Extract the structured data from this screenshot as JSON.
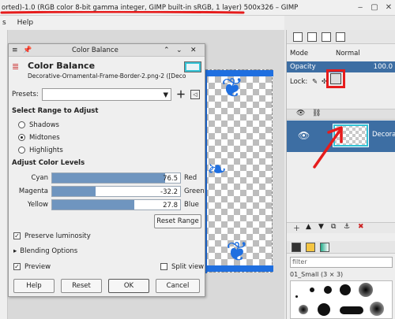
{
  "window": {
    "title": "orted)-1.0 (RGB color 8-bit gamma integer, GIMP built-in sRGB, 1 layer) 500x326 – GIMP"
  },
  "menubar": {
    "items": [
      "s",
      "Help"
    ]
  },
  "dialog": {
    "title": "Color Balance",
    "header_name": "Color Balance",
    "header_file": "Decorative-Ornamental-Frame-Border-2.png-2 ([Deco",
    "presets_label": "Presets:",
    "presets_value": "",
    "range_heading": "Select Range to Adjust",
    "ranges": [
      {
        "label": "Shadows",
        "selected": false
      },
      {
        "label": "Midtones",
        "selected": true
      },
      {
        "label": "Highlights",
        "selected": false
      }
    ],
    "levels_heading": "Adjust Color Levels",
    "sliders": [
      {
        "left": "Cyan",
        "right": "Red",
        "value": "76.5",
        "fraction": 0.88
      },
      {
        "left": "Magenta",
        "right": "Green",
        "value": "-32.2",
        "fraction": 0.34
      },
      {
        "left": "Yellow",
        "right": "Blue",
        "value": "27.8",
        "fraction": 0.64
      }
    ],
    "reset_range_label": "Reset Range",
    "preserve_luminosity_label": "Preserve luminosity",
    "preserve_luminosity_checked": true,
    "blending_options_label": "Blending Options",
    "preview_label": "Preview",
    "preview_checked": true,
    "split_view_label": "Split view",
    "split_view_checked": false,
    "buttons": {
      "help": "Help",
      "reset": "Reset",
      "ok": "OK",
      "cancel": "Cancel"
    }
  },
  "layers": {
    "mode_label": "Mode",
    "mode_value": "Normal",
    "opacity_label": "Opacity",
    "opacity_value": "100.0",
    "lock_label": "Lock:",
    "layer_name": "Decorati"
  },
  "brushes": {
    "filter_placeholder": "filter",
    "brush_name": "01_Small (3 × 3)"
  },
  "colors": {
    "accent": "#3d6ea3",
    "annotation_red": "#e61c1c",
    "ornament_blue": "#1f6fe0"
  }
}
